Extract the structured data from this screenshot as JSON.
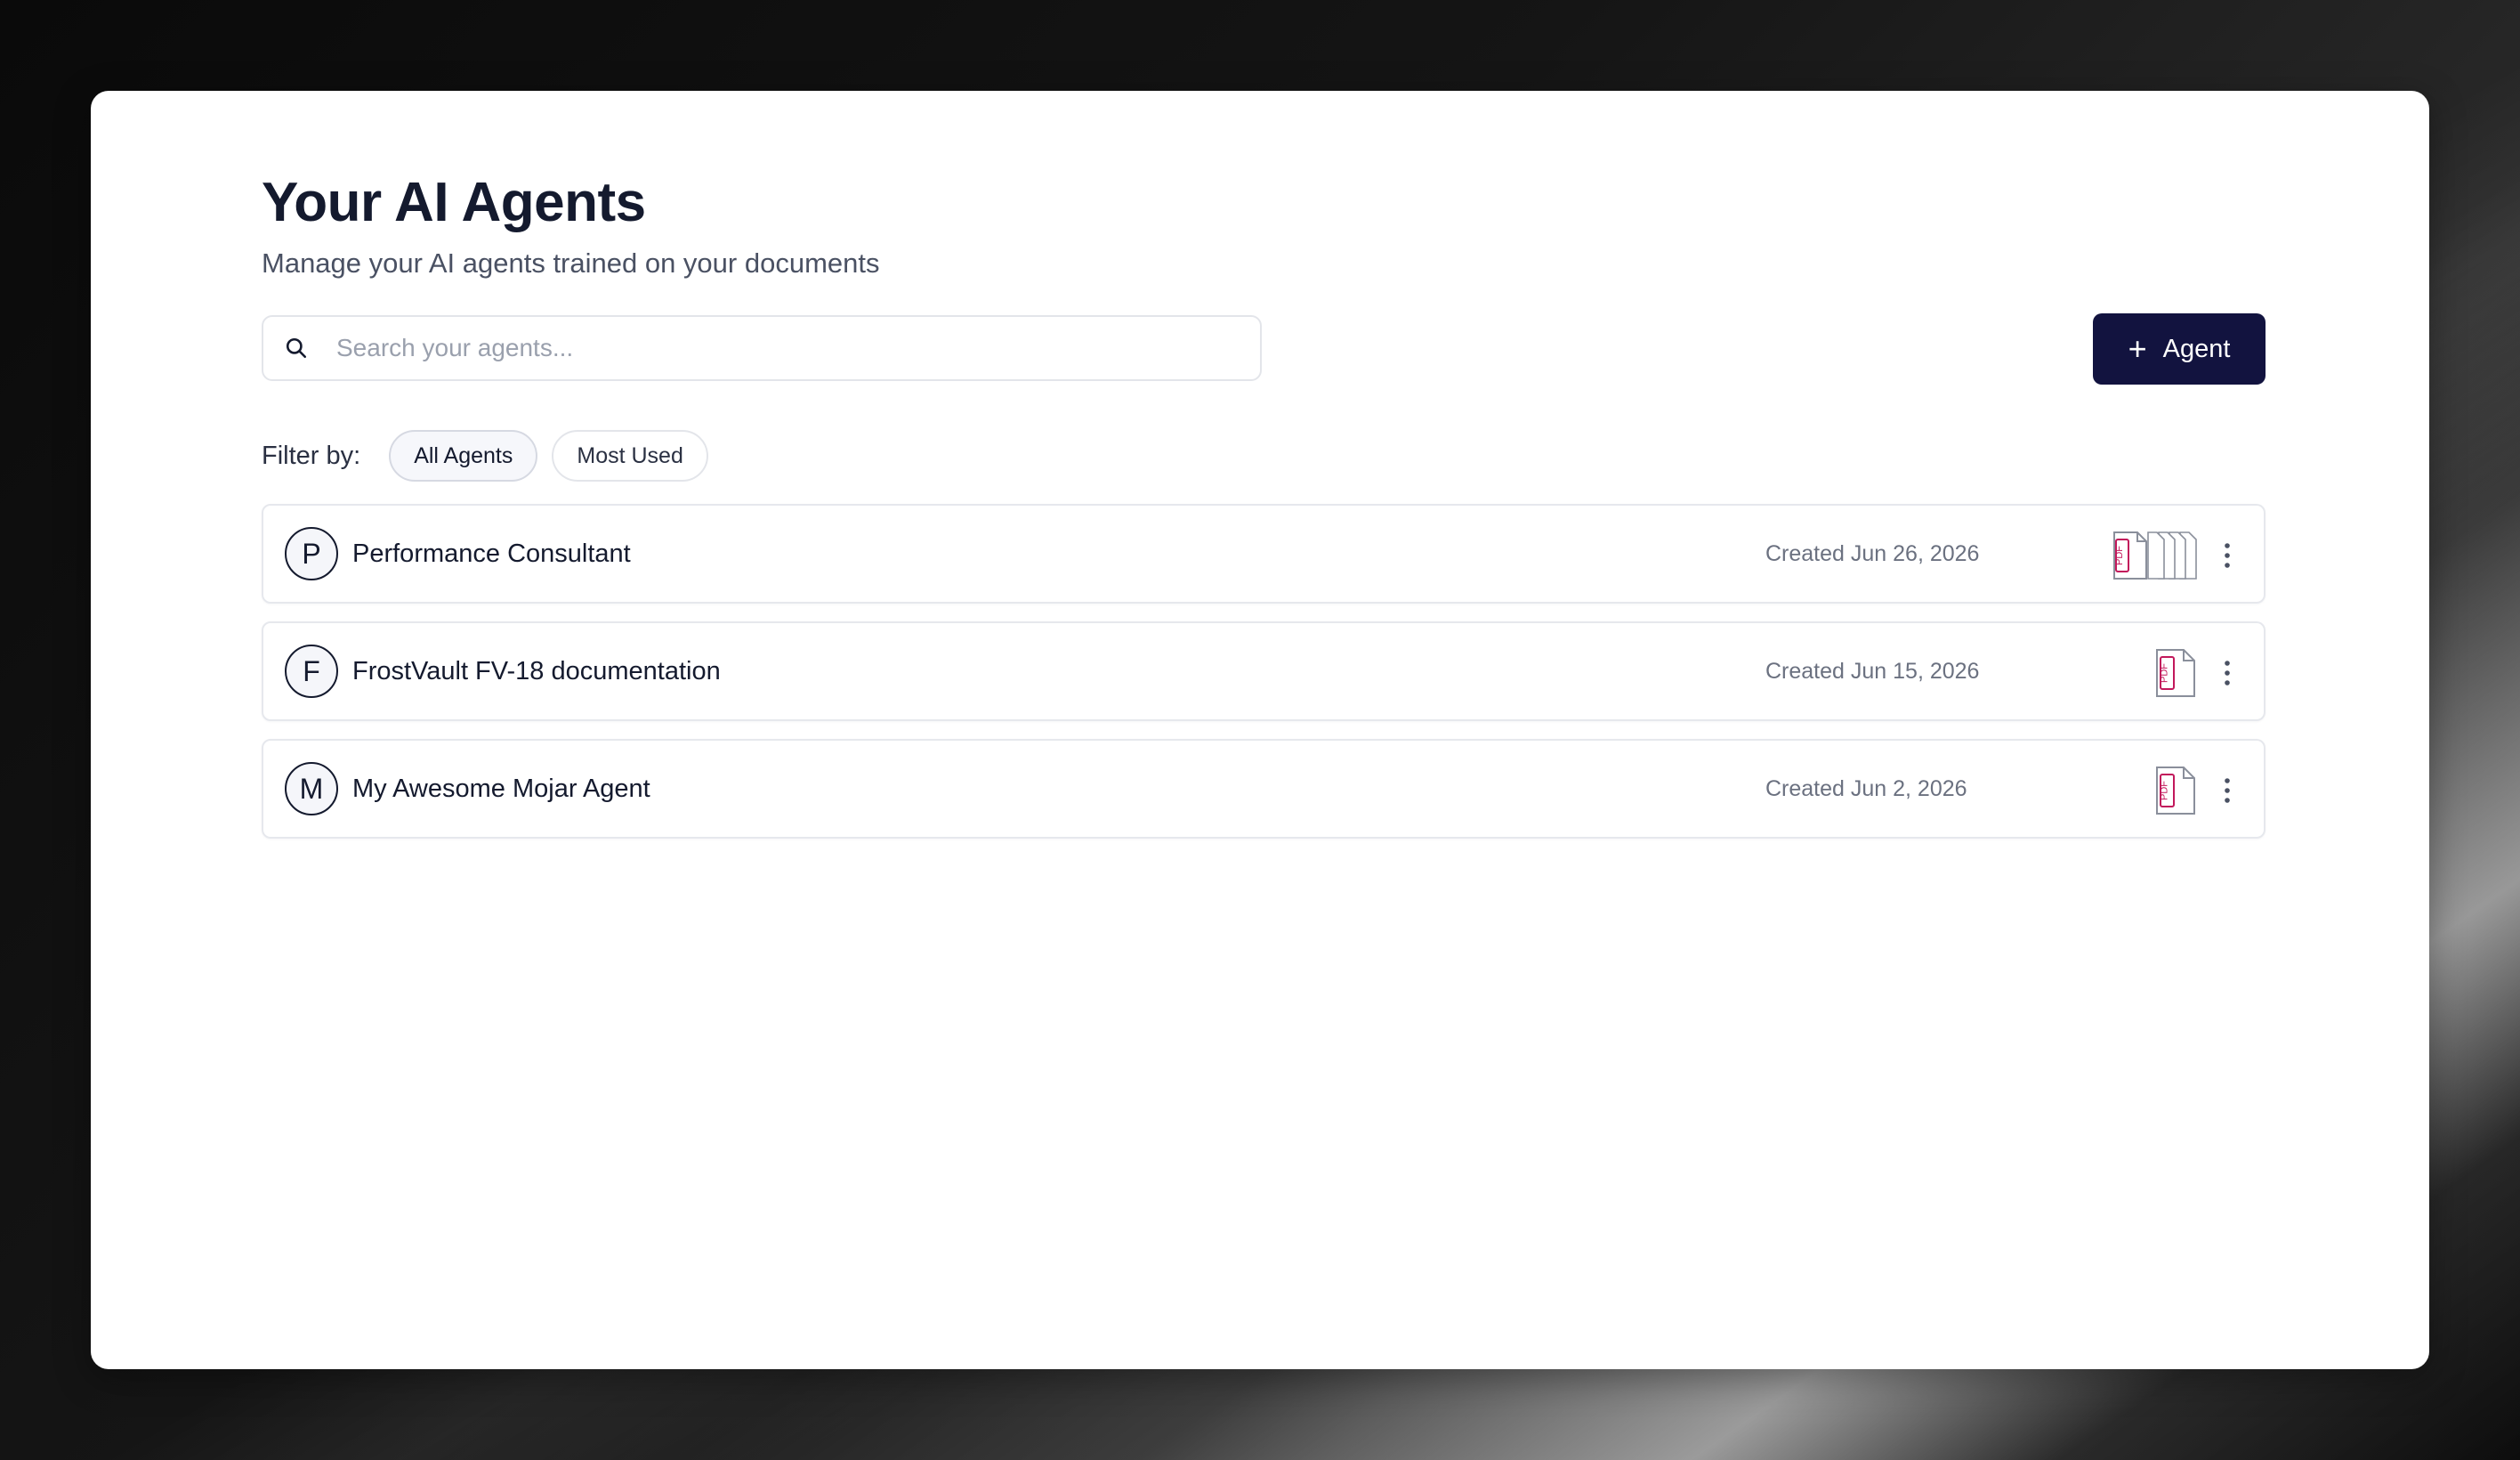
{
  "header": {
    "title": "Your AI Agents",
    "subtitle": "Manage your AI agents trained on your documents"
  },
  "search": {
    "placeholder": "Search your agents...",
    "value": "",
    "icon": "search-icon"
  },
  "add_button": {
    "label": "Agent",
    "icon": "plus-icon"
  },
  "filter": {
    "label": "Filter by:",
    "options": [
      {
        "label": "All Agents",
        "active": true
      },
      {
        "label": "Most Used",
        "active": false
      }
    ]
  },
  "agents": [
    {
      "initial": "P",
      "name": "Performance Consultant",
      "created": "Created Jun 26, 2026",
      "doc_icon": "pdf-stack-icon",
      "doc_label": "PDF"
    },
    {
      "initial": "F",
      "name": "FrostVault FV-18 documentation",
      "created": "Created Jun 15, 2026",
      "doc_icon": "pdf-icon",
      "doc_label": "PDF"
    },
    {
      "initial": "M",
      "name": "My Awesome Mojar Agent",
      "created": "Created Jun 2, 2026",
      "doc_icon": "pdf-icon",
      "doc_label": "PDF"
    }
  ],
  "colors": {
    "primary_button": "#12133f",
    "title_text": "#141a2e",
    "pdf_accent": "#c2185b"
  }
}
